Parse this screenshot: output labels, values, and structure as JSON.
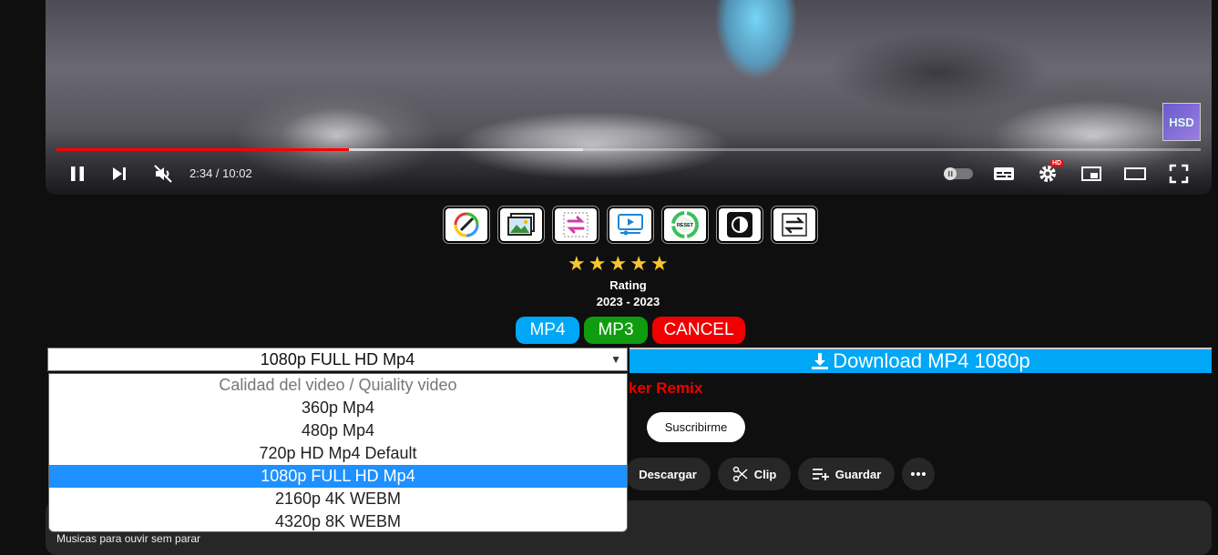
{
  "player": {
    "time": "2:34 / 10:02",
    "progress_fraction": 0.2557,
    "buffer_fraction": 0.46,
    "watermark": "HSD",
    "hd_badge": "HD",
    "icons": [
      "pause-icon",
      "next-icon",
      "mute-icon",
      "autoplay-toggle-icon",
      "subtitles-icon",
      "settings-icon",
      "miniplayer-icon",
      "theater-icon",
      "fullscreen-icon"
    ]
  },
  "toolbar": {
    "icons": [
      "color-palette-icon",
      "image-icon",
      "repeat-icon",
      "player-icon",
      "reset-icon",
      "contrast-icon",
      "swap-icon"
    ]
  },
  "rating": {
    "stars": 5,
    "label": "Rating",
    "years": "2023 - 2023"
  },
  "formats": {
    "mp4": "MP4",
    "mp3": "MP3",
    "cancel": "CANCEL",
    "colors": {
      "mp4": "#00a7f7",
      "mp3": "#0f9d0f",
      "cancel": "#f00000"
    }
  },
  "download": {
    "label": "Download MP4 1080p",
    "selected_quality": "1080p FULL HD Mp4",
    "options": [
      "Calidad del video / Quiality video",
      "360p Mp4",
      "480p Mp4",
      "720p HD Mp4 Default",
      "1080p FULL HD Mp4",
      "2160p 4K WEBM",
      "4320p 8K WEBM"
    ],
    "selected_index": 4
  },
  "video_info": {
    "title_tail": "ker Remix",
    "subscribe": "Suscribirme",
    "actions": {
      "download": "Descargar",
      "clip": "Clip",
      "save": "Guardar"
    },
    "description": "Musicas para ouvir sem parar"
  }
}
